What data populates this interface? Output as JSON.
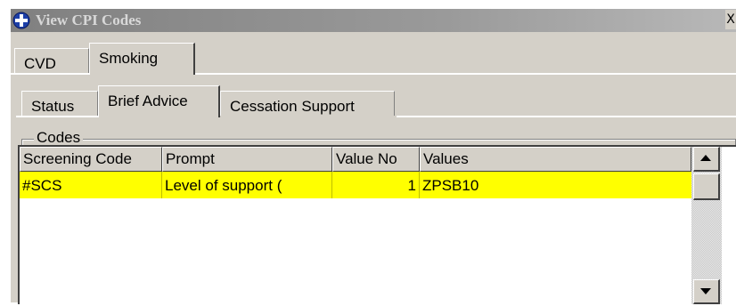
{
  "window": {
    "title": "View CPI Codes",
    "close_glyph": "X",
    "icon": "app-globe-icon"
  },
  "tabs_top": [
    {
      "label": "CVD",
      "active": false
    },
    {
      "label": "Smoking",
      "active": true
    }
  ],
  "tabs_sub": [
    {
      "label": "Status",
      "active": false
    },
    {
      "label": "Brief Advice",
      "active": true
    },
    {
      "label": "Cessation Support",
      "active": false
    }
  ],
  "codes_group": {
    "label": "Codes",
    "columns": [
      "Screening Code",
      "Prompt",
      "Value No",
      "Values"
    ],
    "rows": [
      {
        "screening_code": "#SCS",
        "prompt": "Level of support (",
        "value_no": "1",
        "values": "ZPSB10",
        "selected": true
      }
    ]
  },
  "colors": {
    "selected_row": "#ffff00",
    "face": "#d4d0c8"
  },
  "scrollbar": {
    "up_icon": "arrow-up-icon",
    "down_icon": "arrow-down-icon"
  }
}
